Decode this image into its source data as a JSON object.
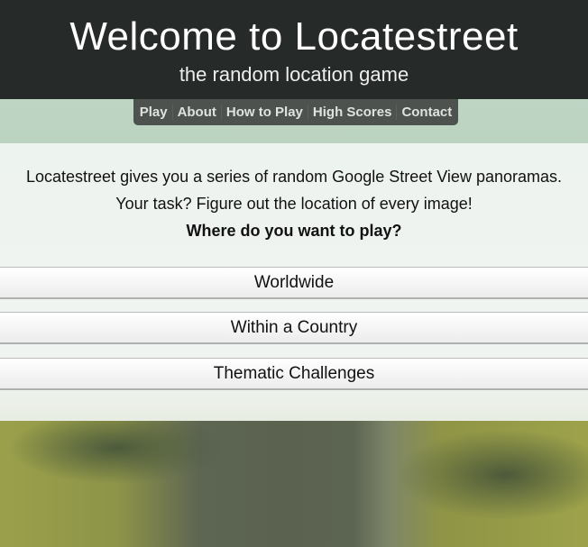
{
  "header": {
    "title": "Welcome to Locatestreet",
    "subtitle": "the random location game"
  },
  "nav": {
    "items": [
      {
        "label": "Play"
      },
      {
        "label": "About"
      },
      {
        "label": "How to Play"
      },
      {
        "label": "High Scores"
      },
      {
        "label": "Contact"
      }
    ]
  },
  "intro": {
    "line1": "Locatestreet gives you a series of random Google Street View panoramas.",
    "line2": "Your task? Figure out the location of every image!",
    "question": "Where do you want to play?"
  },
  "options": [
    {
      "label": "Worldwide"
    },
    {
      "label": "Within a Country"
    },
    {
      "label": "Thematic Challenges"
    }
  ]
}
